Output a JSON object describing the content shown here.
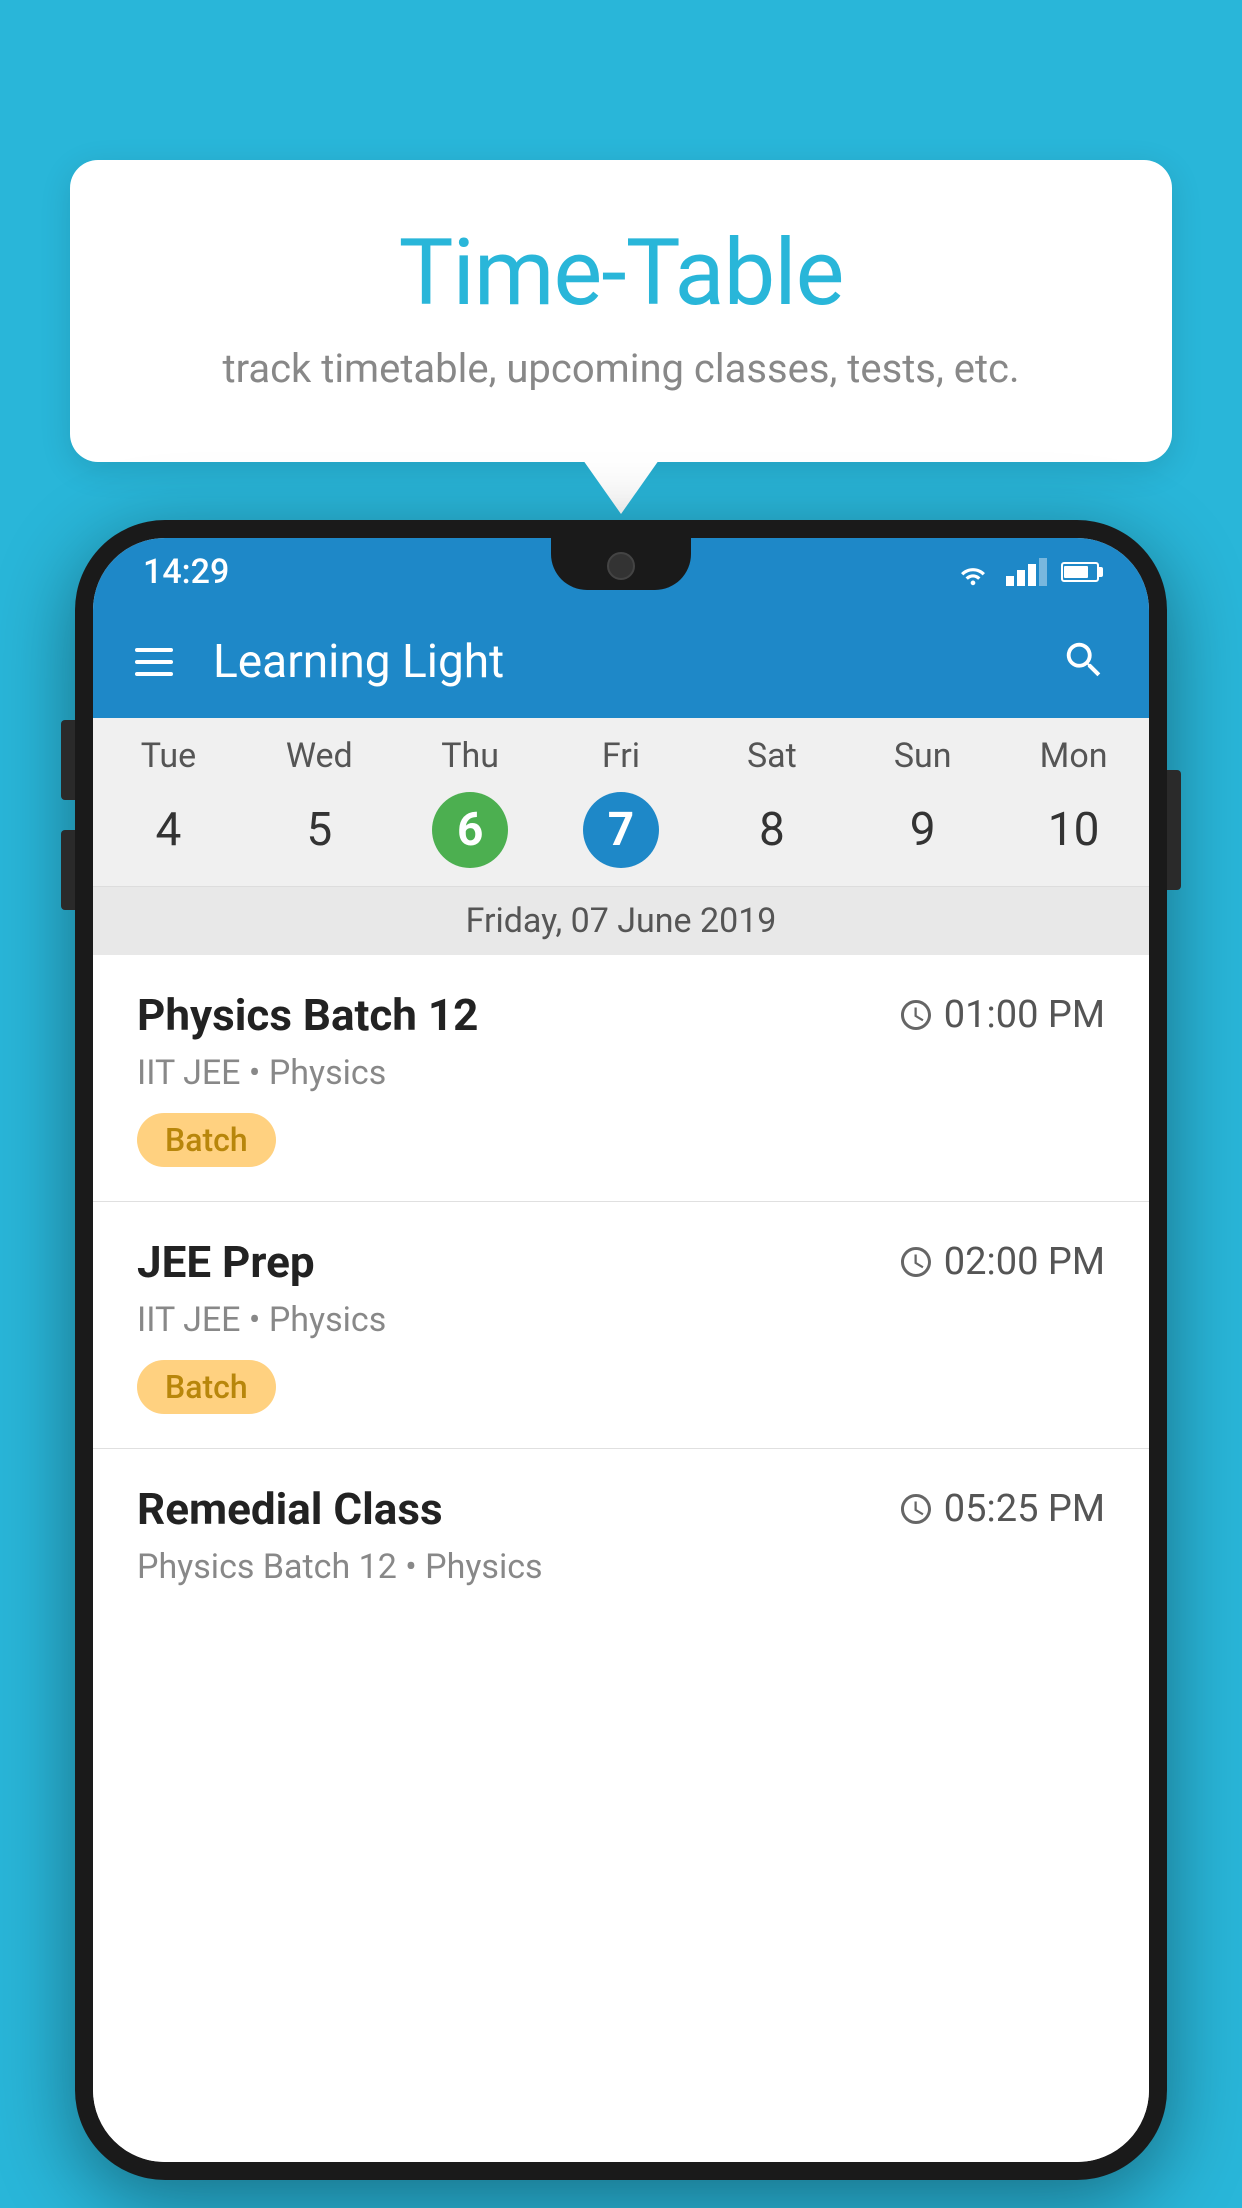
{
  "background_color": "#29b6d9",
  "tooltip": {
    "title": "Time-Table",
    "subtitle": "track timetable, upcoming classes, tests, etc."
  },
  "phone": {
    "status_bar": {
      "time": "14:29",
      "wifi": "▾",
      "signal": "▲",
      "battery": "▪"
    },
    "app_bar": {
      "title": "Learning Light",
      "menu_icon": "≡",
      "search_icon": "⌕"
    },
    "calendar": {
      "days": [
        {
          "name": "Tue",
          "number": "4",
          "type": "normal"
        },
        {
          "name": "Wed",
          "number": "5",
          "type": "normal"
        },
        {
          "name": "Thu",
          "number": "6",
          "type": "green"
        },
        {
          "name": "Fri",
          "number": "7",
          "type": "blue"
        },
        {
          "name": "Sat",
          "number": "8",
          "type": "normal"
        },
        {
          "name": "Sun",
          "number": "9",
          "type": "normal"
        },
        {
          "name": "Mon",
          "number": "10",
          "type": "normal"
        }
      ],
      "selected_date": "Friday, 07 June 2019"
    },
    "schedule": [
      {
        "title": "Physics Batch 12",
        "time": "01:00 PM",
        "subtitle": "IIT JEE • Physics",
        "badge": "Batch"
      },
      {
        "title": "JEE Prep",
        "time": "02:00 PM",
        "subtitle": "IIT JEE • Physics",
        "badge": "Batch"
      },
      {
        "title": "Remedial Class",
        "time": "05:25 PM",
        "subtitle": "Physics Batch 12 • Physics",
        "badge": null
      }
    ]
  }
}
